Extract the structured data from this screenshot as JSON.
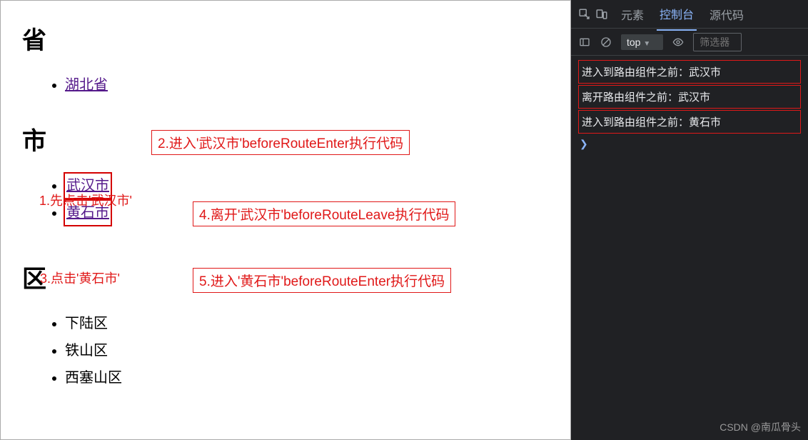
{
  "page": {
    "heading_province": "省",
    "heading_city": "市",
    "heading_district": "区",
    "provinces": [
      "湖北省"
    ],
    "cities": [
      "武汉市",
      "黄石市"
    ],
    "districts": [
      "下陆区",
      "铁山区",
      "西塞山区"
    ]
  },
  "annotations": {
    "a1": "1.先点击'武汉市'",
    "a2": "2.进入'武汉市'beforeRouteEnter执行代码",
    "a3": "3.点击'黄石市'",
    "a4": "4.离开'武汉市'beforeRouteLeave执行代码",
    "a5": "5.进入'黄石市'beforeRouteEnter执行代码"
  },
  "devtools": {
    "tabs": {
      "elements": "元素",
      "console": "控制台",
      "sources": "源代码"
    },
    "toolbar": {
      "context": "top",
      "filter_placeholder": "筛选器"
    },
    "logs": [
      "进入到路由组件之前：武汉市",
      "离开路由组件之前：武汉市",
      "进入到路由组件之前：黄石市"
    ],
    "prompt": "❯"
  },
  "watermark": "CSDN @南瓜骨头"
}
